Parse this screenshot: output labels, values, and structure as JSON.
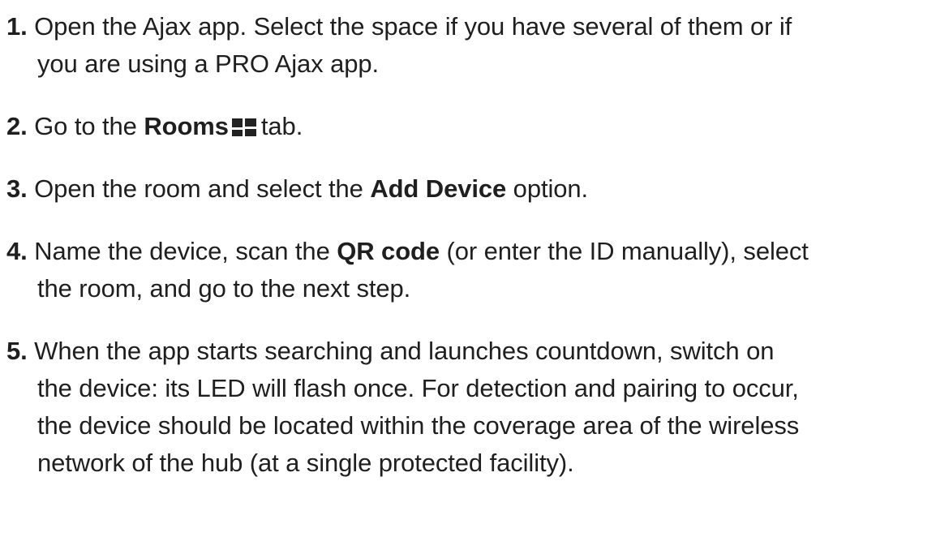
{
  "steps": [
    {
      "num": "1.",
      "line1": "Open the Ajax app. Select the space if you have several of them or if",
      "line2": "you are using a PRO Ajax app."
    },
    {
      "num": "2.",
      "pre": "Go to the",
      "bold": "Rooms",
      "icon": "rooms-icon",
      "post": "tab."
    },
    {
      "num": "3.",
      "pre": "Open the room and select the",
      "bold": "Add Device",
      "post": "option."
    },
    {
      "num": "4.",
      "pre": "Name the device, scan the",
      "bold": "QR code",
      "post": "(or enter the ID manually), select",
      "line2": "the room, and go to the next step."
    },
    {
      "num": "5.",
      "line1": "When the app starts searching and launches countdown, switch on",
      "line2": "the device: its LED will flash once. For detection and pairing to occur,",
      "line3": "the device should be located within the coverage area of the wireless",
      "line4": "network of the hub (at a single protected facility)."
    }
  ]
}
